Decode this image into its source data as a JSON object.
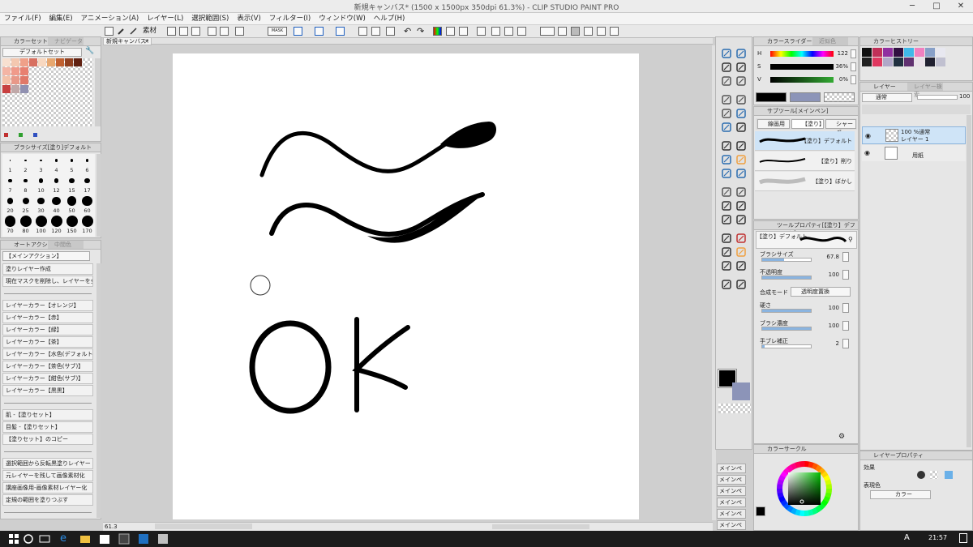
{
  "window": {
    "title": "新規キャンバス* (1500 x 1500px 350dpi 61.3%) - CLIP STUDIO PAINT PRO",
    "minimize": "─",
    "maximize": "□",
    "close": "✕"
  },
  "menu": [
    "ファイル(F)",
    "編集(E)",
    "アニメーション(A)",
    "レイヤー(L)",
    "選択範囲(S)",
    "表示(V)",
    "フィルター(I)",
    "ウィンドウ(W)",
    "ヘルプ(H)"
  ],
  "toolbar": {
    "material_label": "素材",
    "mask_label": "MASK"
  },
  "canvas_tab": {
    "label": "新規キャンバス*",
    "close": "×"
  },
  "canvas_drawing": {
    "text": "OK"
  },
  "status": {
    "zoom": "61.3"
  },
  "color_set": {
    "tabs": [
      "カラーセット",
      "ナビゲーター"
    ],
    "selected": "デフォルトセット",
    "colors": [
      "#f8e0d0",
      "#f4c8b0",
      "#f0a088",
      "#d87060",
      "#f8d8c0",
      "#e8a870",
      "#c06030",
      "#904020",
      "#602010",
      "#f4b4a4",
      "#f09a8a",
      "#e88070",
      "#f4c0a8",
      "#e89888",
      "#e07868",
      "#c84040",
      "#c0a8a8",
      "#9090b0"
    ]
  },
  "brush_size": {
    "title": "ブラシサイズ[塗り]デフォルト",
    "sizes": [
      "1",
      "2",
      "3",
      "4",
      "5",
      "6",
      "7",
      "8",
      "10",
      "12",
      "15",
      "17",
      "20",
      "25",
      "30",
      "40",
      "50",
      "60",
      "70",
      "80",
      "100",
      "120",
      "150",
      "170"
    ]
  },
  "auto_action": {
    "tabs": [
      "オートアクション",
      "中間色"
    ],
    "selected": "【メインアクション】",
    "items": [
      "塗りレイヤー作成",
      "現在マスクを削除し、レイヤーを全マ...",
      "",
      "レイヤーカラー【オレンジ】",
      "レイヤーカラー【赤】",
      "レイヤーカラー【緑】",
      "レイヤーカラー【茶】",
      "レイヤーカラー【水色(デフォルト)】",
      "レイヤーカラー【茶色(サブ)】",
      "レイヤーカラー【紺色(サブ)】",
      "レイヤーカラー【黒黒】",
      "",
      "肌 -【塗りセット】",
      "目髪 -【塗りセット】",
      "【塗りセット】のコピー",
      "",
      "選択範囲から反転黒塗りレイヤー",
      "元レイヤーを残して画像素材化",
      "講座画像用-画像素材レイヤー化",
      "定規の範囲を塗りつぶす",
      ""
    ]
  },
  "color_slider": {
    "tabs": [
      "カラースライダー",
      "近似色"
    ],
    "rows": [
      {
        "label": "H",
        "value": "122"
      },
      {
        "label": "S",
        "value": "36%"
      },
      {
        "label": "V",
        "value": "0%"
      }
    ]
  },
  "subtool": {
    "title": "サブツール[メインペン]",
    "tabs": [
      "線画用",
      "【塗り】",
      "シャーペ"
    ],
    "items": [
      "【塗り】デフォルト",
      "【塗り】削り",
      "【塗り】ぼかし"
    ]
  },
  "tool_property": {
    "title": "ツールプロパティ[【塗り】デフォルト]",
    "brush_name": "【塗り】デフォルト",
    "rows": [
      {
        "label": "ブラシサイズ",
        "value": "67.8",
        "fill": 0.45
      },
      {
        "label": "不透明度",
        "value": "100",
        "fill": 1.0
      },
      {
        "label": "硬さ",
        "value": "100",
        "fill": 1.0
      },
      {
        "label": "ブラシ濃度",
        "value": "100",
        "fill": 1.0
      },
      {
        "label": "手ブレ補正",
        "value": "2",
        "fill": 0.05
      }
    ],
    "blend_label": "合成モード",
    "blend_value": "透明度置換"
  },
  "color_history": {
    "title": "カラーヒストリー",
    "colors": [
      "#101010",
      "#c03058",
      "#9030a0",
      "#301040",
      "#40b8e8",
      "#f080c0",
      "#88a0c8",
      "#e8e8f0",
      "#202020",
      "#e03860",
      "#b0a8c8",
      "#203040",
      "#603070",
      "#e8e0e8",
      "#202030",
      "#c0c0d0"
    ]
  },
  "layer": {
    "tabs": [
      "レイヤー",
      "レイヤー検索"
    ],
    "blend": "通常",
    "opacity": "100",
    "layers": [
      {
        "meta": "100 %通常",
        "name": "レイヤー 1"
      },
      {
        "meta": "",
        "name": "用紙"
      }
    ]
  },
  "color_circle": {
    "title": "カラーサークル",
    "current_hex": "#2e7d2e"
  },
  "layer_property": {
    "title": "レイヤープロパティ",
    "effect_label": "効果",
    "display_color_label": "表現色",
    "display_color_value": "カラー"
  },
  "navigator_buttons": [
    "メインペ",
    "メインペ",
    "メインペ",
    "メインペ",
    "メインペ",
    "メインペ",
    "メインペ"
  ],
  "taskbar": {
    "time": "21:57",
    "ime": "A"
  },
  "colors": {
    "canvas_bg": "#ffffff",
    "workspace": "#cfcfcf",
    "accent_orange": "#f0a040",
    "taskbar": "#1c1c1c"
  }
}
